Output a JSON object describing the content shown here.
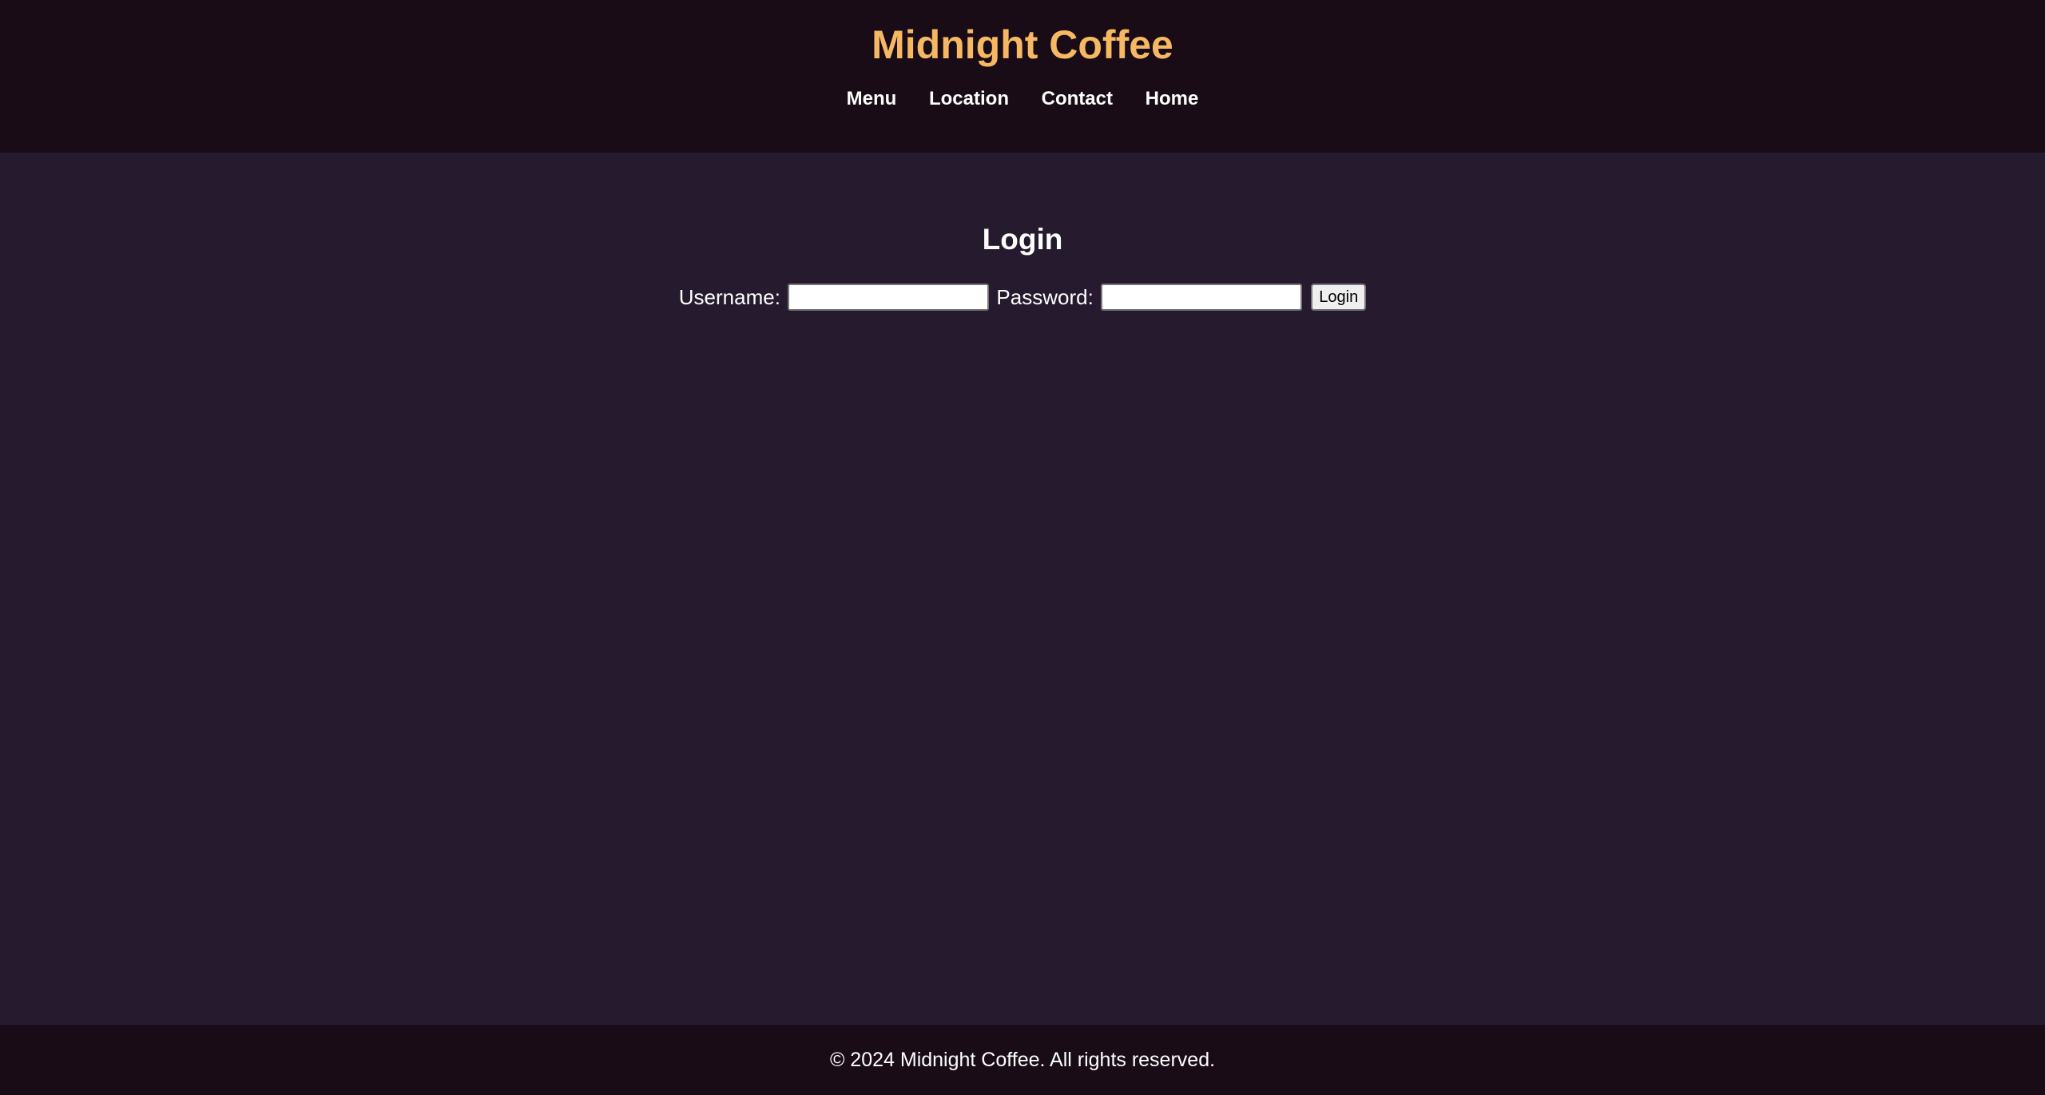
{
  "header": {
    "site_title": "Midnight Coffee",
    "nav": [
      {
        "label": "Menu"
      },
      {
        "label": "Location"
      },
      {
        "label": "Contact"
      },
      {
        "label": "Home"
      }
    ]
  },
  "login": {
    "title": "Login",
    "username_label": "Username:",
    "username_value": "",
    "password_label": "Password:",
    "password_value": "",
    "submit_label": "Login"
  },
  "footer": {
    "copyright": "© 2024 Midnight Coffee. All rights reserved."
  },
  "colors": {
    "header_bg": "#190c17",
    "page_bg": "#261a2e",
    "accent": "#f6b863",
    "text": "#ffffff"
  }
}
